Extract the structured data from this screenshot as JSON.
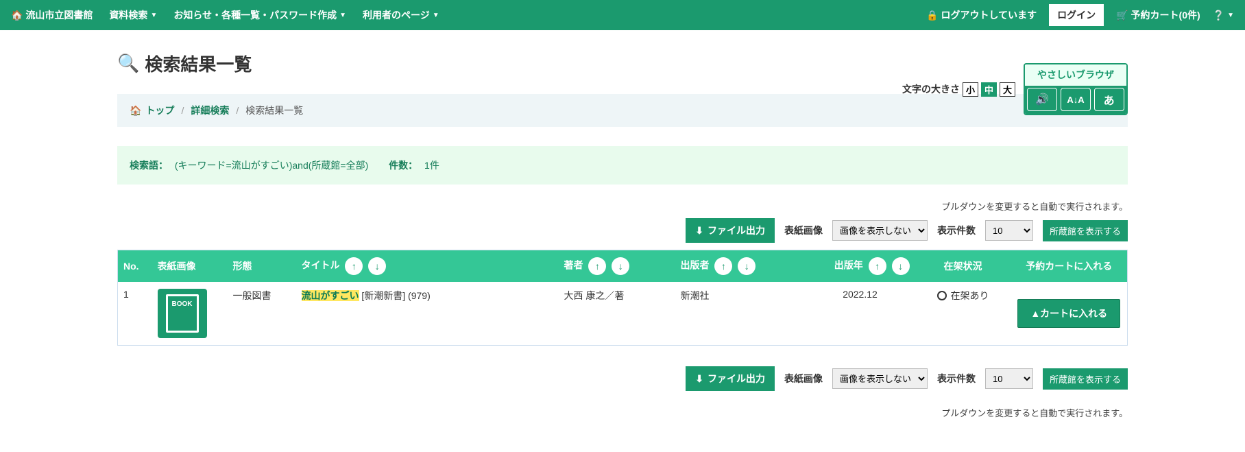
{
  "navbar": {
    "home": "流山市立図書館",
    "search": "資料検索",
    "news": "お知らせ・各種一覧・パスワード作成",
    "user_page": "利用者のページ",
    "logout_status": "ログアウトしています",
    "login": "ログイン",
    "cart": "予約カート(0件)"
  },
  "font_size": {
    "label": "文字の大きさ",
    "small": "小",
    "medium": "中",
    "large": "大"
  },
  "browser_widget": {
    "title": "やさしいブラウザ"
  },
  "page_title": "検索結果一覧",
  "breadcrumb": {
    "top": "トップ",
    "advanced": "詳細検索",
    "current": "検索結果一覧"
  },
  "search_summary": {
    "query_label": "検索語：",
    "query": "(キーワード=流山がすごい)and(所蔵館=全部)",
    "count_label": "件数：",
    "count": "1件"
  },
  "auto_note": "プルダウンを変更すると自動で実行されます。",
  "toolbar": {
    "file_out": "ファイル出力",
    "cover_label": "表紙画像",
    "cover_option": "画像を表示しない",
    "per_page_label": "表示件数",
    "per_page_option": "10",
    "library_btn": "所蔵館を表示する"
  },
  "columns": {
    "no": "No.",
    "cover": "表紙画像",
    "format": "形態",
    "title": "タイトル",
    "author": "著者",
    "publisher": "出版者",
    "year": "出版年",
    "stock": "在架状況",
    "cart": "予約カートに入れる"
  },
  "row": {
    "no": "1",
    "format": "一般図書",
    "title_highlight": "流山がすごい",
    "title_rest": "   [新潮新書] (979)",
    "author": "大西 康之／著",
    "publisher": "新潮社",
    "year": "2022.12",
    "stock": "在架あり",
    "cart_btn": "▲カートに入れる"
  }
}
